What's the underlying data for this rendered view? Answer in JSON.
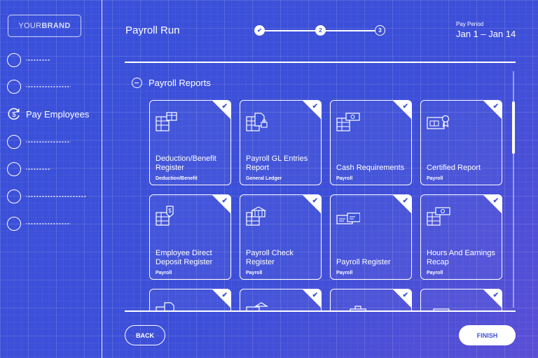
{
  "brand": {
    "prefix": "YOUR",
    "bold": "BRAND"
  },
  "nav": {
    "active_label": "Pay Employees"
  },
  "header": {
    "title": "Payroll Run",
    "steps": [
      "2",
      "3"
    ],
    "period_label": "Pay Period",
    "period_value": "Jan 1 – Jan 14"
  },
  "section": {
    "title": "Payroll Reports"
  },
  "cards": [
    {
      "title": "Deduction/Benefit Register",
      "sub": "Deduction/Benefit",
      "icon": "table-gift-icon"
    },
    {
      "title": "Payroll GL Entries Report",
      "sub": "General Ledger",
      "icon": "document-lock-icon"
    },
    {
      "title": "Cash Requirements",
      "sub": "Payroll",
      "icon": "table-cash-icon"
    },
    {
      "title": "Certified Report",
      "sub": "Payroll",
      "icon": "certificate-icon"
    },
    {
      "title": "Employee Direct Deposit Register",
      "sub": "Payroll",
      "icon": "table-dollar-icon"
    },
    {
      "title": "Payroll Check Register",
      "sub": "Payroll",
      "icon": "table-bank-icon"
    },
    {
      "title": "Payroll Register",
      "sub": "Payroll",
      "icon": "checks-icon"
    },
    {
      "title": "Hours And Earnings Recap",
      "sub": "Payroll",
      "icon": "table-money-icon"
    }
  ],
  "buttons": {
    "back": "BACK",
    "finish": "FINISH"
  },
  "colors": {
    "background": "#3b52d9",
    "accent": "#ffffff"
  }
}
